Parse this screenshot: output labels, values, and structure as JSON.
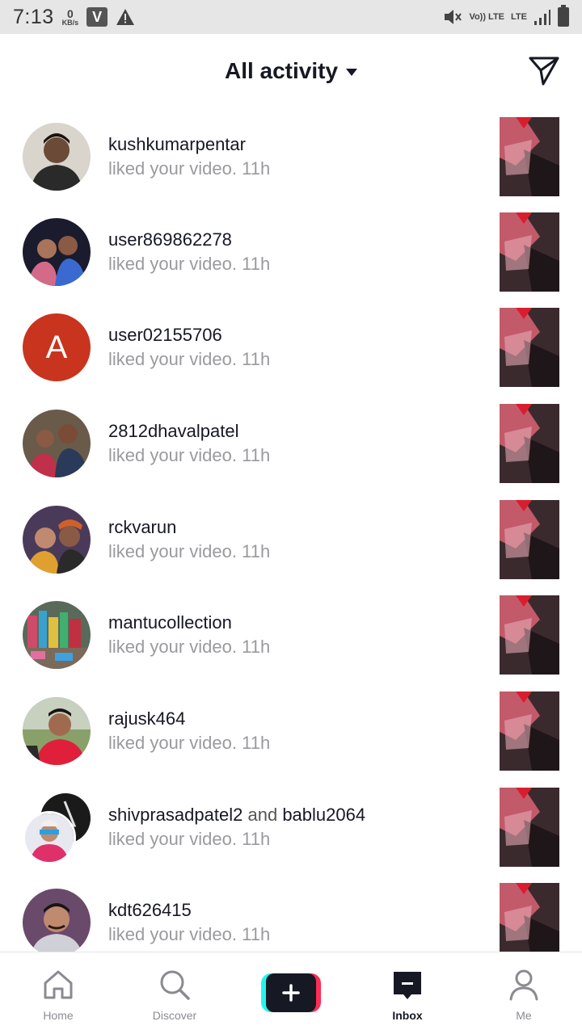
{
  "status_bar": {
    "time": "7:13",
    "net_speed_value": "0",
    "net_speed_unit": "KB/s",
    "app_badge": "V",
    "volte_label": "Vo)) LTE",
    "lte_label": "LTE"
  },
  "header": {
    "title": "All activity",
    "title_dropdown_icon": "caret-down-icon",
    "direct_message_icon": "paper-plane-icon"
  },
  "activities": [
    {
      "username": "kushkumarpentar",
      "text": "liked your video.",
      "time": "11h"
    },
    {
      "username": "user869862278",
      "text": "liked your video.",
      "time": "11h"
    },
    {
      "username": "user02155706",
      "avatar_letter": "A",
      "avatar_color": "#c9341e",
      "text": "liked your video.",
      "time": "11h"
    },
    {
      "username": "2812dhavalpatel",
      "text": "liked your video.",
      "time": "11h"
    },
    {
      "username": "rckvarun",
      "text": "liked your video.",
      "time": "11h"
    },
    {
      "username": "mantucollection",
      "text": "liked your video.",
      "time": "11h"
    },
    {
      "username": "rajusk464",
      "text": "liked your video.",
      "time": "11h"
    },
    {
      "username": "shivprasadpatel2",
      "joiner": "and",
      "username2": "bablu2064",
      "text": "liked your video.",
      "time": "11h"
    },
    {
      "username": "kdt626415",
      "text": "liked your video.",
      "time": "11h"
    }
  ],
  "nav": {
    "home": "Home",
    "discover": "Discover",
    "inbox": "Inbox",
    "me": "Me",
    "active_tab": "Inbox"
  },
  "colors": {
    "accent_pink": "#fe2c55",
    "accent_cyan": "#25f4ee",
    "text_dark": "#161823",
    "text_muted": "#9a9a9e"
  }
}
